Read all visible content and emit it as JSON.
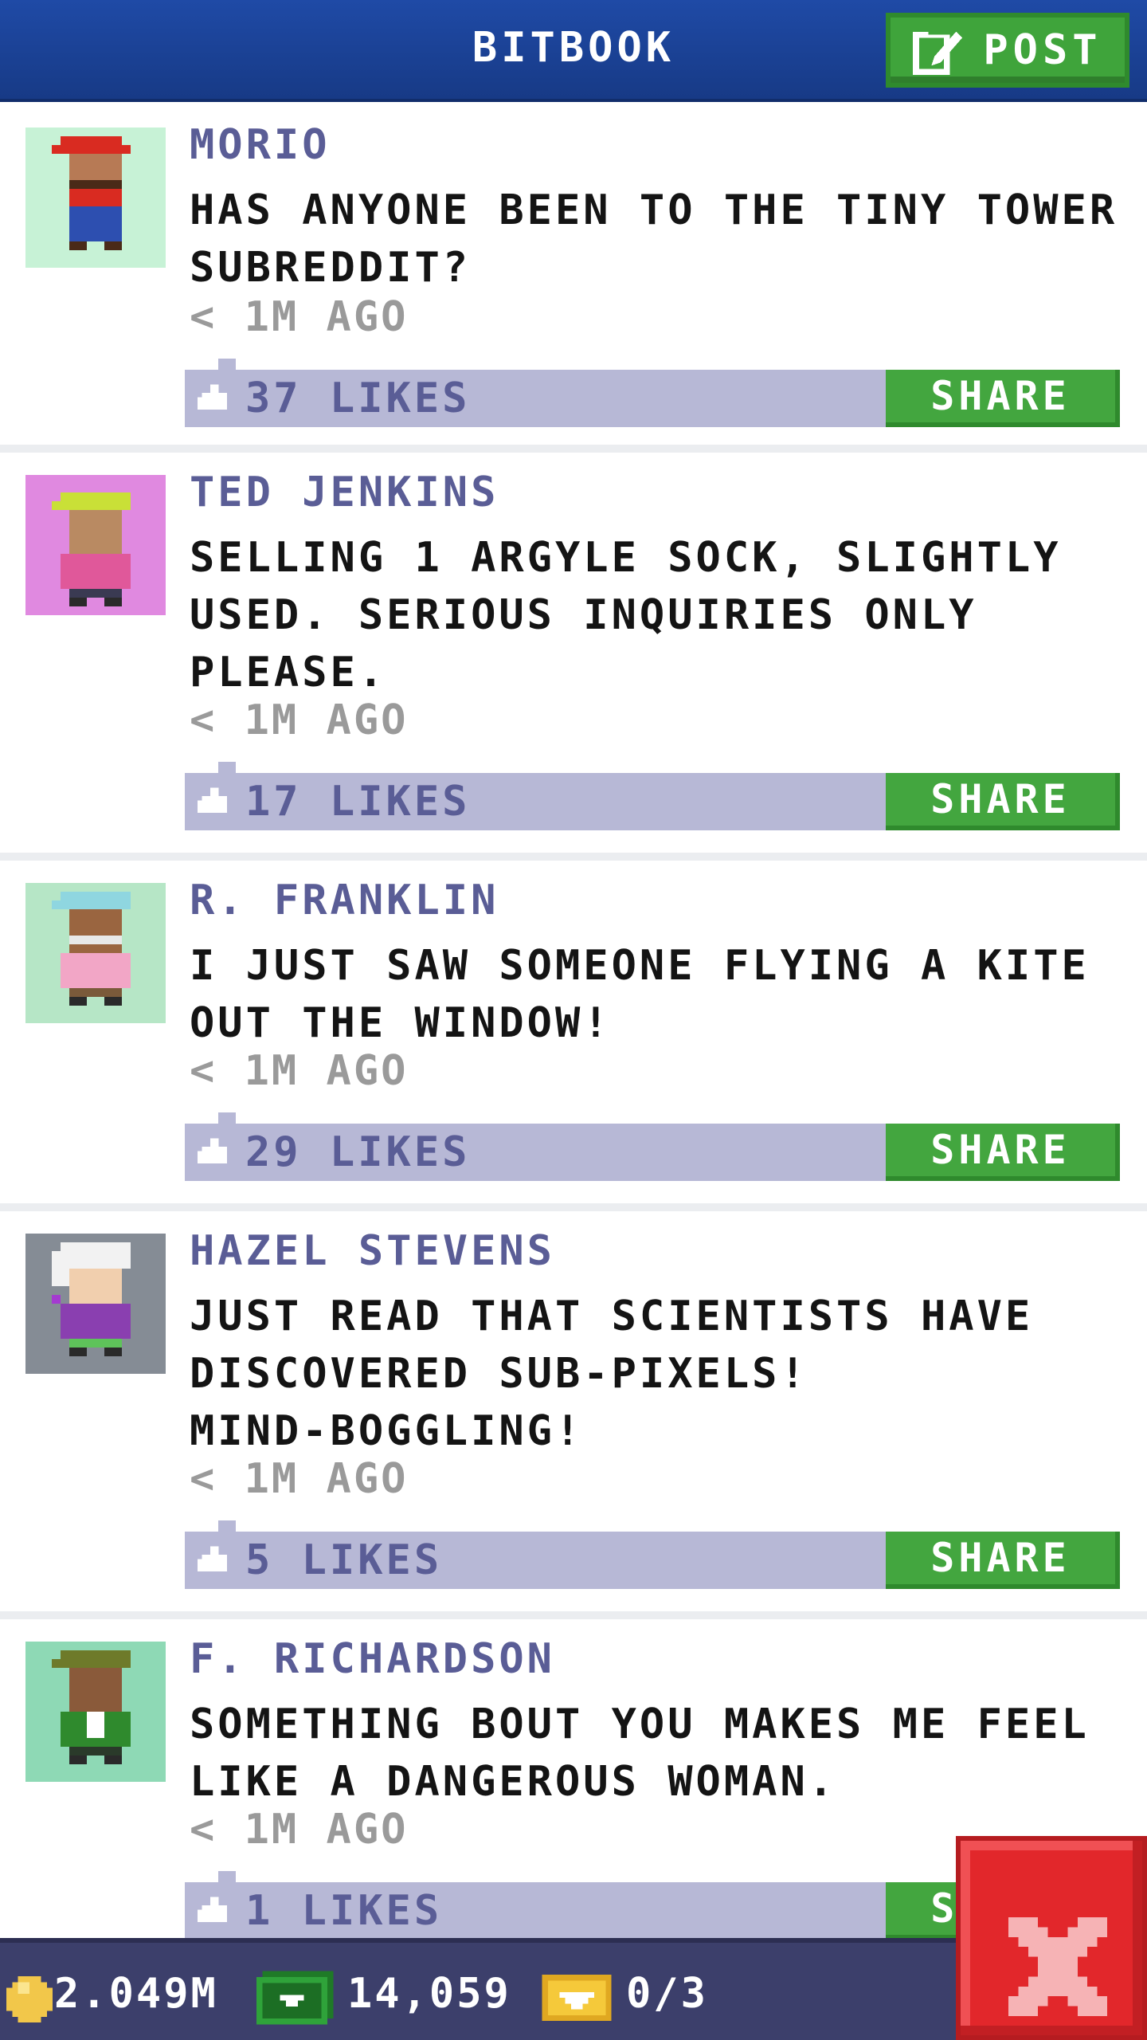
{
  "header": {
    "title": "BITBOOK",
    "post_label": "POST"
  },
  "posts": [
    {
      "author": "MORIO",
      "message_lines": [
        "HAS ANYONE BEEN TO THE TINY TOWER",
        "SUBREDDIT?"
      ],
      "time": "< 1M AGO",
      "likes": "37 LIKES",
      "share_label": "SHARE",
      "avatar_bg": "#c7f2d6"
    },
    {
      "author": "TED JENKINS",
      "message_lines": [
        "SELLING 1 ARGYLE SOCK, SLIGHTLY",
        "USED. SERIOUS INQUIRIES ONLY",
        "PLEASE."
      ],
      "time": "< 1M AGO",
      "likes": "17 LIKES",
      "share_label": "SHARE",
      "avatar_bg": "#e089e0"
    },
    {
      "author": "R. FRANKLIN",
      "message_lines": [
        "I JUST SAW SOMEONE FLYING A KITE",
        "OUT THE WINDOW!"
      ],
      "time": "< 1M AGO",
      "likes": "29 LIKES",
      "share_label": "SHARE",
      "avatar_bg": "#b6e6c6"
    },
    {
      "author": "HAZEL STEVENS",
      "message_lines": [
        "JUST READ THAT SCIENTISTS HAVE",
        "DISCOVERED SUB-PIXELS!",
        "MIND-BOGGLING!"
      ],
      "time": "< 1M AGO",
      "likes": "5 LIKES",
      "share_label": "SHARE",
      "avatar_bg": "#858c95"
    },
    {
      "author": "F. RICHARDSON",
      "message_lines": [
        "SOMETHING BOUT YOU MAKES ME FEEL",
        "LIKE A DANGEROUS WOMAN."
      ],
      "time": "< 1M AGO",
      "likes": "1 LIKES",
      "share_label": "SHARE",
      "avatar_bg": "#8ed9b5"
    }
  ],
  "status_bar": {
    "coins": "2.049M",
    "bux": "14,059",
    "tickets": "0/3"
  },
  "colors": {
    "header_blue": "#1f4aa6",
    "action_green": "#43a63f",
    "likes_bar": "#b7b8d6",
    "author_text": "#5a5d96",
    "close_red": "#e2272b"
  }
}
